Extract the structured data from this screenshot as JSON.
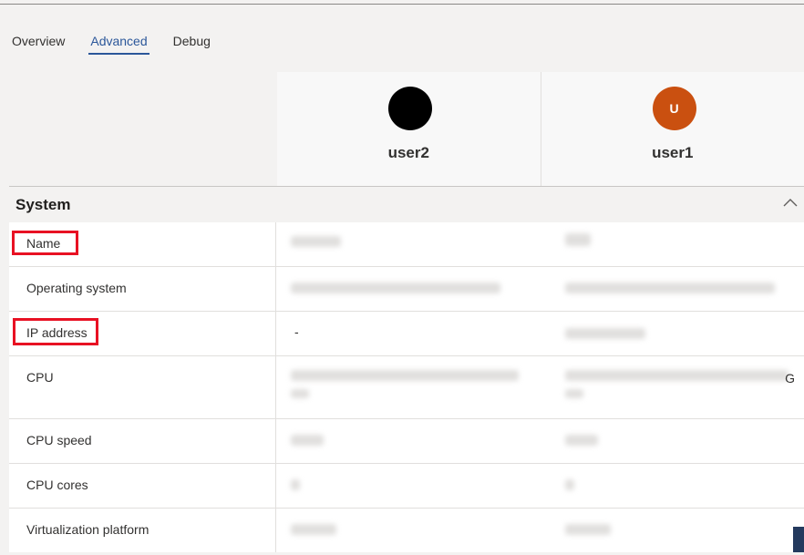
{
  "tabs": [
    {
      "label": "Overview",
      "active": false
    },
    {
      "label": "Advanced",
      "active": true
    },
    {
      "label": "Debug",
      "active": false
    }
  ],
  "users": [
    {
      "name": "user2",
      "avatar_initial": "",
      "avatar_color": "#000000"
    },
    {
      "name": "user1",
      "avatar_initial": "U",
      "avatar_color": "#ca5010"
    }
  ],
  "section": {
    "title": "System",
    "icon": "chevron-up-icon"
  },
  "rows": [
    {
      "label": "Name",
      "user2_value": "",
      "user1_value": "",
      "highlighted": true
    },
    {
      "label": "Operating system",
      "user2_value": "",
      "user1_value": "",
      "highlighted": false
    },
    {
      "label": "IP address",
      "user2_value": "-",
      "user1_value": "",
      "highlighted": true
    },
    {
      "label": "CPU",
      "user2_value": "",
      "user1_value": "G",
      "highlighted": false
    },
    {
      "label": "CPU speed",
      "user2_value": "",
      "user1_value": "",
      "highlighted": false
    },
    {
      "label": "CPU cores",
      "user2_value": "",
      "user1_value": "",
      "highlighted": false
    },
    {
      "label": "Virtualization platform",
      "user2_value": "",
      "user1_value": "",
      "highlighted": false
    }
  ]
}
